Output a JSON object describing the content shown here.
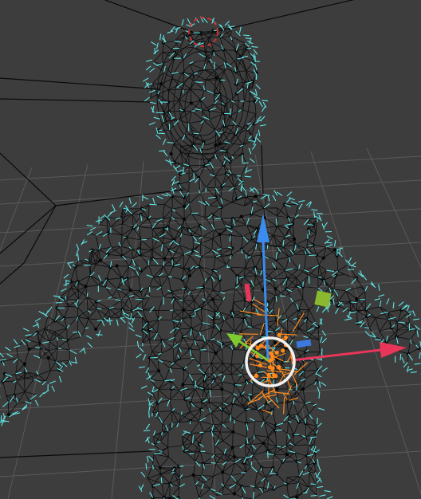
{
  "viewport": {
    "background_color": "#3d3d3d",
    "grid_color": "#5a5a5a",
    "mesh_wire_color": "#0c0c0c",
    "mesh_vertex_color": "#050505",
    "normals_color": "#5fe6e6",
    "selection_color": "#ff8a1a",
    "origin_marker_color": "#d03030",
    "structure_line_color": "#0a0a0a"
  },
  "gizmo": {
    "x_axis_color": "#e8365a",
    "y_axis_color": "#7ec830",
    "z_axis_color": "#3a8cf0",
    "pivot_ring_color": "#f2f2f2",
    "plane_x_color": "#e8365a",
    "plane_y_color": "#8ab830",
    "plane_z_color": "#3a7ae0"
  },
  "icons": {
    "origin": "object-origin-icon",
    "pivot": "pivot-ring-icon",
    "x_arrow": "x-axis-arrow-icon",
    "y_arrow": "y-axis-arrow-icon",
    "z_arrow": "z-axis-arrow-icon"
  }
}
